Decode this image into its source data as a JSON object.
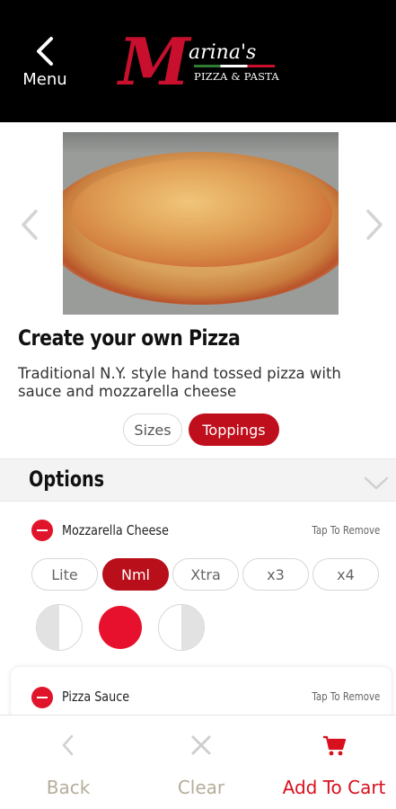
{
  "header": {
    "back_label": "Menu",
    "logo_letter": "M",
    "logo_name": "arina's",
    "logo_sub": "PIZZA & PASTA"
  },
  "product": {
    "title": "Create your own Pizza",
    "description": "Traditional N.Y. style hand tossed pizza with sauce and mozzarella cheese"
  },
  "tabs": [
    {
      "label": "Sizes",
      "active": false
    },
    {
      "label": "Toppings",
      "active": true
    }
  ],
  "options": {
    "header": "Options",
    "items": [
      {
        "name": "Mozzarella Cheese",
        "action": "Tap To Remove",
        "amounts": [
          "Lite",
          "Nml",
          "Xtra",
          "x3",
          "x4"
        ],
        "selected_amount": "Nml",
        "placement": [
          "left-half",
          "whole",
          "right-half"
        ],
        "selected_placement": "whole"
      },
      {
        "name": "Pizza Sauce",
        "action": "Tap To Remove"
      }
    ]
  },
  "bottom": {
    "back_label": "Back",
    "clear_label": "Clear",
    "cart_label": "Add To Cart"
  },
  "colors": {
    "accent": "#c00f1c",
    "header_bg": "#000000",
    "muted": "#b5ad9a"
  },
  "icons": {
    "back": "chevron-left-icon",
    "prev": "chevron-left-icon",
    "next": "chevron-right-icon",
    "collapse": "chevron-down-icon",
    "clear": "close-icon",
    "cart": "cart-icon"
  }
}
